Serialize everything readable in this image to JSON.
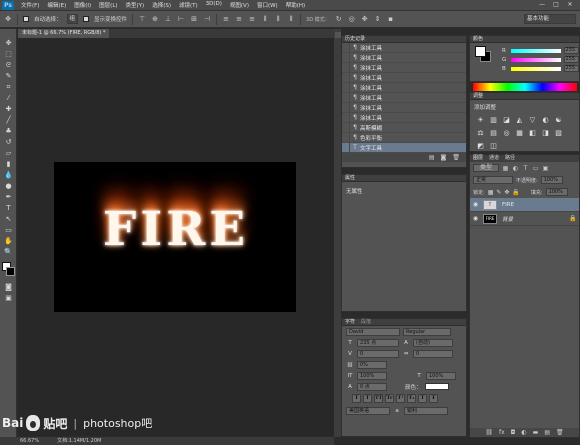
{
  "app": {
    "logo": "Ps",
    "menus": [
      "文件(F)",
      "编辑(E)",
      "图像(I)",
      "图层(L)",
      "类型(Y)",
      "选择(S)",
      "滤镜(T)",
      "3D(D)",
      "视图(V)",
      "窗口(W)",
      "帮助(H)"
    ],
    "window_controls": [
      "—",
      "□",
      "✕"
    ]
  },
  "options_bar": {
    "auto_select_label": "自动选择：",
    "auto_select_value": "组",
    "show_transform_label": "显示变换控件",
    "mode_3d_label": "3D 模式：",
    "workspace": "基本功能"
  },
  "tools": [
    "move-icon",
    "marquee-icon",
    "lasso-icon",
    "quick-select-icon",
    "crop-icon",
    "eyedropper-icon",
    "healing-icon",
    "brush-icon",
    "stamp-icon",
    "history-brush-icon",
    "eraser-icon",
    "gradient-icon",
    "blur-icon",
    "dodge-icon",
    "pen-icon",
    "type-icon",
    "path-select-icon",
    "shape-icon",
    "hand-icon",
    "zoom-icon"
  ],
  "tool_glyphs": [
    "✥",
    "⬚",
    "ᘓ",
    "✎",
    "⌗",
    "⁄",
    "✚",
    "╱",
    "♣",
    "↺",
    "▱",
    "▮",
    "💧",
    "●",
    "✒",
    "T",
    "↖",
    "▭",
    "✋",
    "🔍"
  ],
  "document": {
    "tab_title": "未标题-1 @ 66.7% (FIRE, RGB/8) *",
    "art_text": "FIRE"
  },
  "status_bar": {
    "zoom": "66.67%",
    "doc_info": "文档:1.14M/1.20M"
  },
  "watermark": {
    "brand": "Bai",
    "brand2": "贴吧",
    "separator": "|",
    "text": "photoshop吧"
  },
  "history": {
    "title": "历史记录",
    "items": [
      "涂抹工具",
      "涂抹工具",
      "涂抹工具",
      "涂抹工具",
      "涂抹工具",
      "涂抹工具",
      "涂抹工具",
      "涂抹工具",
      "高斯模糊",
      "色彩平衡",
      "文字工具"
    ],
    "selected_index": 10
  },
  "properties": {
    "title": "属性",
    "empty_text": "无属性"
  },
  "character": {
    "tabs": [
      "字符",
      "段落"
    ],
    "font_family": "David",
    "font_style": "Regular",
    "size": "235 点",
    "leading": "(自动)",
    "kerning": "0",
    "tracking": "0",
    "scale_v": "0%",
    "scale_h": "100%",
    "scale_h2": "100%",
    "baseline": "0 点",
    "color_label": "颜色：",
    "style_buttons": [
      "T",
      "T",
      "TT",
      "Tr",
      "T¹",
      "T₁",
      "T",
      "Ŧ"
    ],
    "language": "美国英语",
    "antialias": "锐利"
  },
  "color": {
    "title": "颜色",
    "r_label": "R",
    "r": "255",
    "g_label": "G",
    "g": "255",
    "b_label": "B",
    "b": "255"
  },
  "adjustments": {
    "title": "调整",
    "subtitle": "添加调整",
    "icons": [
      "☀",
      "▥",
      "◪",
      "◭",
      "▽",
      "◐",
      "☯",
      "⚖",
      "▤",
      "◎",
      "▦",
      "◧",
      "◨",
      "▧",
      "◩",
      "◫"
    ]
  },
  "layers": {
    "tabs": [
      "图层",
      "通道",
      "路径"
    ],
    "filter_label": "类型",
    "blend_mode": "正常",
    "opacity_label": "不透明度:",
    "opacity": "100%",
    "lock_label": "锁定:",
    "fill_label": "填充:",
    "fill": "100%",
    "list": [
      {
        "name": "FIRE",
        "thumb": "T",
        "selected": true
      },
      {
        "name": "背景",
        "thumb": "FIRE",
        "selected": false
      }
    ]
  }
}
